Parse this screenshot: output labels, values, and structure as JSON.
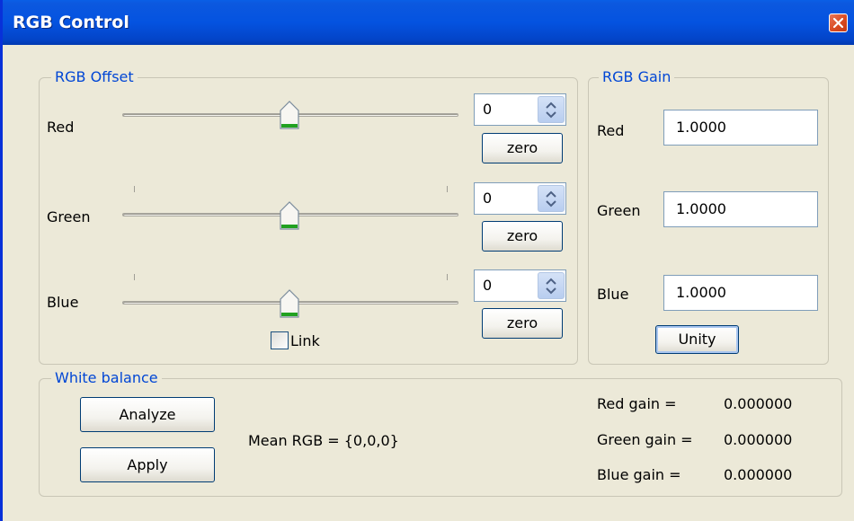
{
  "window": {
    "title": "RGB Control"
  },
  "offset": {
    "title": "RGB Offset",
    "rows": [
      {
        "label": "Red",
        "value": "0",
        "zero_label": "zero"
      },
      {
        "label": "Green",
        "value": "0",
        "zero_label": "zero"
      },
      {
        "label": "Blue",
        "value": "0",
        "zero_label": "zero"
      }
    ],
    "link_label": "Link",
    "link_checked": false
  },
  "gain": {
    "title": "RGB Gain",
    "rows": [
      {
        "label": "Red",
        "value": "1.0000"
      },
      {
        "label": "Green",
        "value": "1.0000"
      },
      {
        "label": "Blue",
        "value": "1.0000"
      }
    ],
    "unity_label": "Unity"
  },
  "white_balance": {
    "title": "White balance",
    "analyze_label": "Analyze",
    "apply_label": "Apply",
    "mean_text": "Mean RGB = {0,0,0}",
    "gains": [
      {
        "label": "Red gain =",
        "value": "0.000000"
      },
      {
        "label": "Green gain =",
        "value": "0.000000"
      },
      {
        "label": "Blue gain =",
        "value": "0.000000"
      }
    ]
  },
  "colors": {
    "titlebar": "#0453e0",
    "group_title": "#0046d5",
    "window_bg": "#ece9d8",
    "thumb_accent": "#21a121"
  }
}
